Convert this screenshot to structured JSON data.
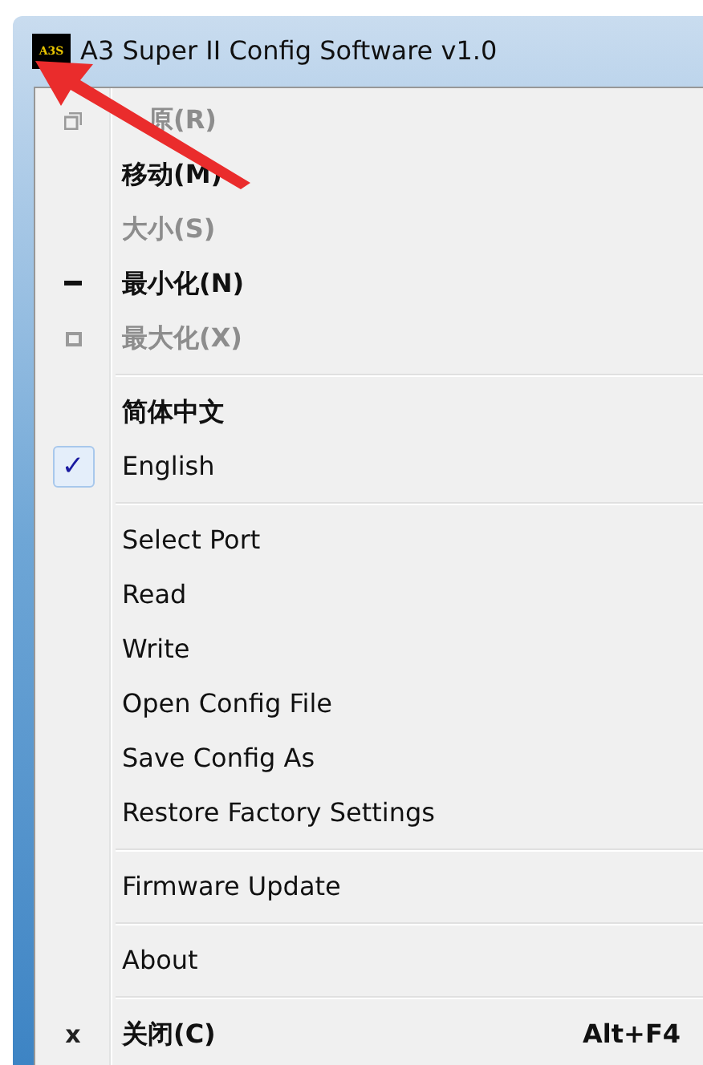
{
  "window": {
    "title": "A3 Super II Config Software v1.0",
    "app_icon_text": "A3S"
  },
  "menu_groups": [
    {
      "items": [
        {
          "label": "原(R)",
          "kind": "restore",
          "disabled": true
        },
        {
          "label": "移动(M)",
          "kind": "plain",
          "disabled": false
        },
        {
          "label": "大小(S)",
          "kind": "plain",
          "disabled": true
        },
        {
          "label": "最小化(N)",
          "kind": "minimize",
          "disabled": false
        },
        {
          "label": "最大化(X)",
          "kind": "maximize",
          "disabled": true
        }
      ]
    },
    {
      "check_glyph": "✓",
      "items": [
        {
          "label": "简体中文",
          "kind": "checkable",
          "disabled": false,
          "checked": false
        },
        {
          "label": "English",
          "kind": "checkable",
          "disabled": false,
          "checked": true
        }
      ]
    },
    {
      "items": [
        {
          "label": "Select Port",
          "kind": "plain",
          "disabled": false
        },
        {
          "label": "Read",
          "kind": "plain",
          "disabled": false
        },
        {
          "label": "Write",
          "kind": "plain",
          "disabled": false
        },
        {
          "label": "Open Config File",
          "kind": "plain",
          "disabled": false
        },
        {
          "label": "Save Config As",
          "kind": "plain",
          "disabled": false
        },
        {
          "label": "Restore Factory Settings",
          "kind": "plain",
          "disabled": false
        }
      ]
    },
    {
      "items": [
        {
          "label": "Firmware Update",
          "kind": "plain",
          "disabled": false
        }
      ]
    },
    {
      "items": [
        {
          "label": "About",
          "kind": "plain",
          "disabled": false
        }
      ]
    },
    {
      "items": [
        {
          "label": "关闭(C)",
          "kind": "close",
          "disabled": false,
          "icon_text": "x",
          "shortcut": "Alt+F4"
        }
      ]
    }
  ]
}
